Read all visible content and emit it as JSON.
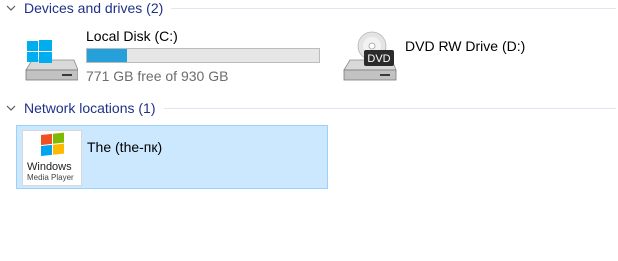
{
  "groups": {
    "devices": {
      "title": "Devices and drives (2)"
    },
    "network": {
      "title": "Network locations (1)"
    }
  },
  "drives": {
    "local_disk": {
      "label": "Local Disk (C:)",
      "free_text": "771 GB free of 930 GB",
      "used_fraction": 0.171,
      "bar_color": "#26a0da",
      "icon": "windows-drive-icon"
    },
    "dvd": {
      "label": "DVD RW Drive (D:)",
      "icon": "dvd-drive-icon",
      "badge": "DVD"
    }
  },
  "network_locations": {
    "item": {
      "label": "The (the-пк)",
      "icon": "windows-media-player-icon",
      "logo_text_1": "Windows",
      "logo_text_2": "Media Player"
    }
  },
  "colors": {
    "group_title": "#1e3287",
    "selection_bg": "#cce8ff",
    "selection_border": "#99d1ff"
  }
}
